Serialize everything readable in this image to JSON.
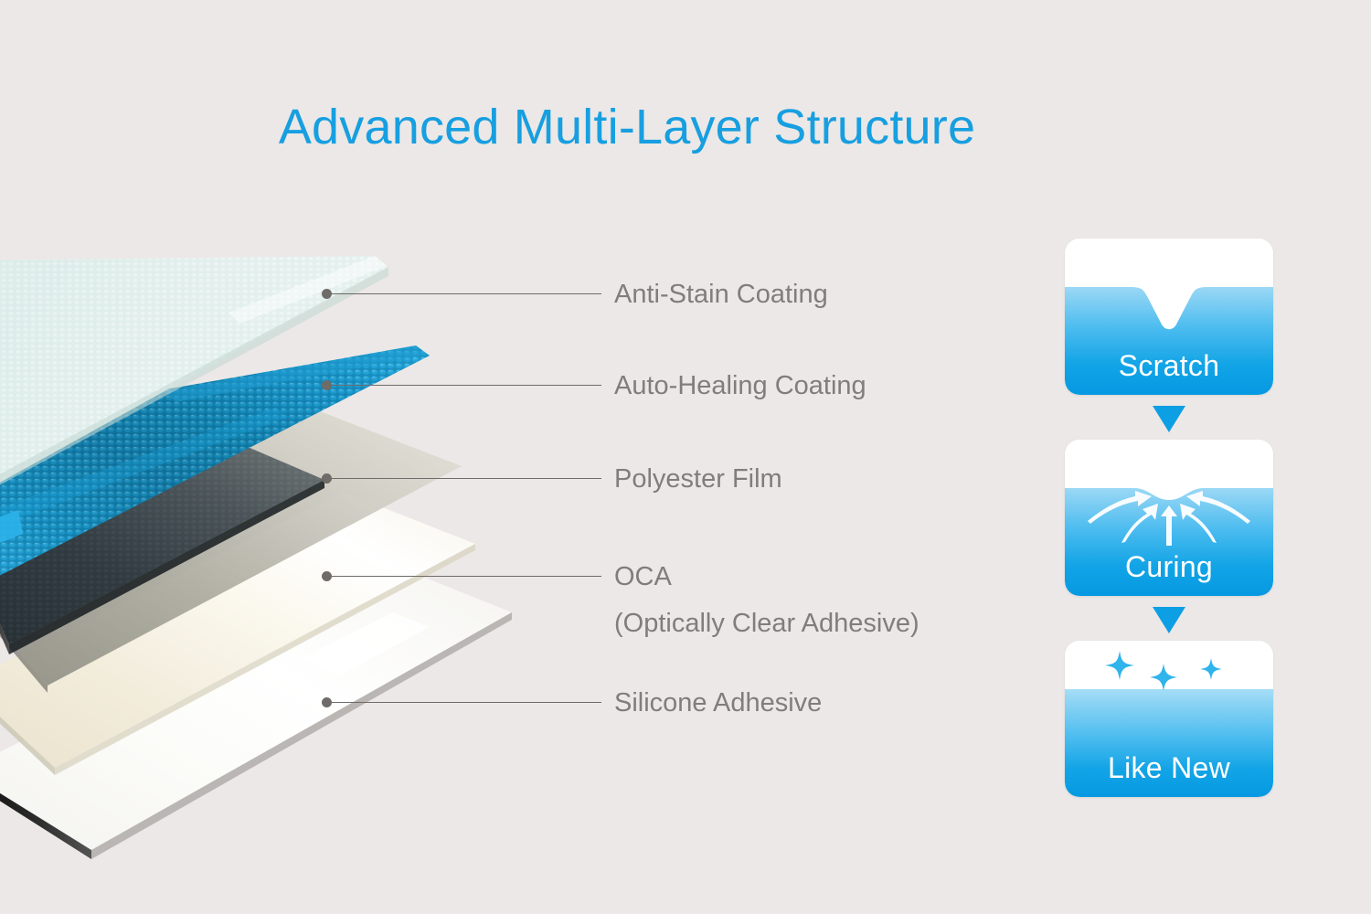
{
  "page": {
    "title": "Advanced Multi-Layer Structure",
    "background_color": "#ece8e7",
    "accent_color": "#179fe0",
    "label_color": "#817d7b",
    "leader_color": "#6e6b69"
  },
  "diagram": {
    "name": "exploded-layer-stack",
    "layers": [
      {
        "id": "anti-stain-coating",
        "label": "Anti-Stain Coating",
        "sublabel": "",
        "appearance": "pale mint translucent textured sheet",
        "color": "#dfece9",
        "order": 1
      },
      {
        "id": "auto-healing-coating",
        "label": "Auto-Healing Coating",
        "sublabel": "",
        "appearance": "blue bead / microsphere grid",
        "color": "#1487b8",
        "order": 2
      },
      {
        "id": "polyester-film",
        "label": "Polyester Film",
        "sublabel": "",
        "appearance": "dark smoked translucent film",
        "color": "#3b4347",
        "order": 3
      },
      {
        "id": "oca",
        "label": "OCA",
        "sublabel": "(Optically Clear Adhesive)",
        "appearance": "cream ivory clear adhesive sheet",
        "color": "#eee8d8",
        "order": 4
      },
      {
        "id": "silicone-adhesive",
        "label": "Silicone Adhesive",
        "sublabel": "",
        "appearance": "white glossy base sheet",
        "color": "#fdfdfb",
        "order": 5
      }
    ]
  },
  "process": {
    "name": "self-healing-process",
    "steps": [
      {
        "id": "scratch",
        "caption": "Scratch",
        "icon": "v-notch-gouge-icon",
        "description": "deep V-shaped gouge cut into the coating surface"
      },
      {
        "id": "curing",
        "caption": "Curing",
        "icon": "converging-arrows-icon",
        "description": "five white arrows converge inward filling a shallow dimple"
      },
      {
        "id": "like-new",
        "caption": "Like New",
        "icon": "sparkle-stars-icon",
        "description": "three blue four-point sparkles over a flat restored surface"
      }
    ],
    "arrow_icon": "triangle-down-icon",
    "card_gradient_top": "#97d6f4",
    "card_gradient_bottom": "#069ce4"
  }
}
